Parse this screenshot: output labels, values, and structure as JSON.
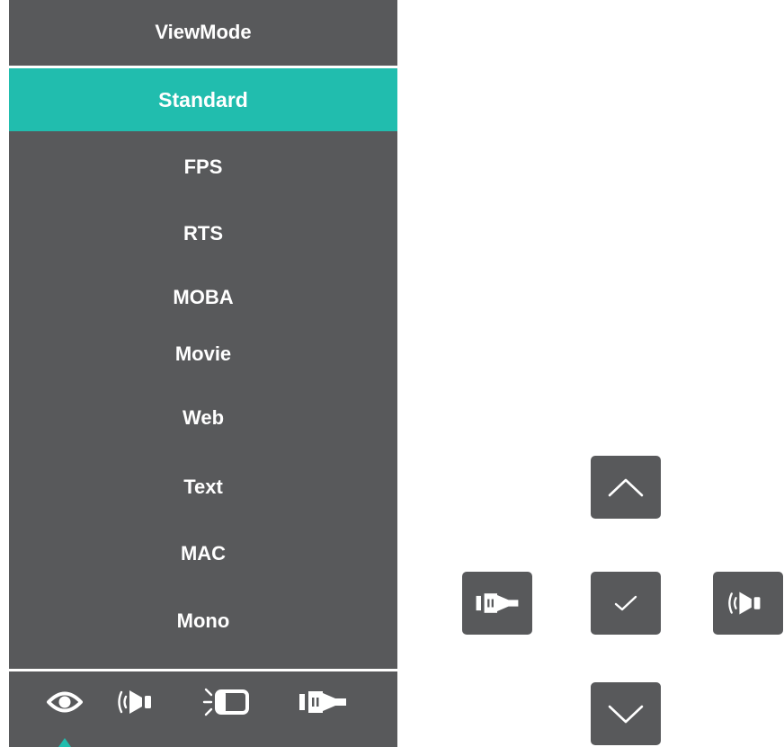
{
  "menu": {
    "title": "ViewMode",
    "selected_index": 0,
    "items": [
      {
        "label": "Standard"
      },
      {
        "label": "FPS"
      },
      {
        "label": "RTS"
      },
      {
        "label": "MOBA"
      },
      {
        "label": "Movie"
      },
      {
        "label": "Web"
      },
      {
        "label": "Text"
      },
      {
        "label": "MAC"
      },
      {
        "label": "Mono"
      }
    ]
  },
  "bottom_bar": {
    "icons": [
      "eye-icon",
      "audio-mode-icon",
      "display-icon",
      "input-source-icon"
    ],
    "active_index": 0
  },
  "keys": {
    "up": "chevron-up-icon",
    "left": "input-source-icon",
    "ok": "checkmark-icon",
    "right": "audio-mode-icon",
    "down": "chevron-down-icon"
  },
  "colors": {
    "panel": "#58595b",
    "accent": "#21bdae",
    "text": "#ffffff"
  }
}
